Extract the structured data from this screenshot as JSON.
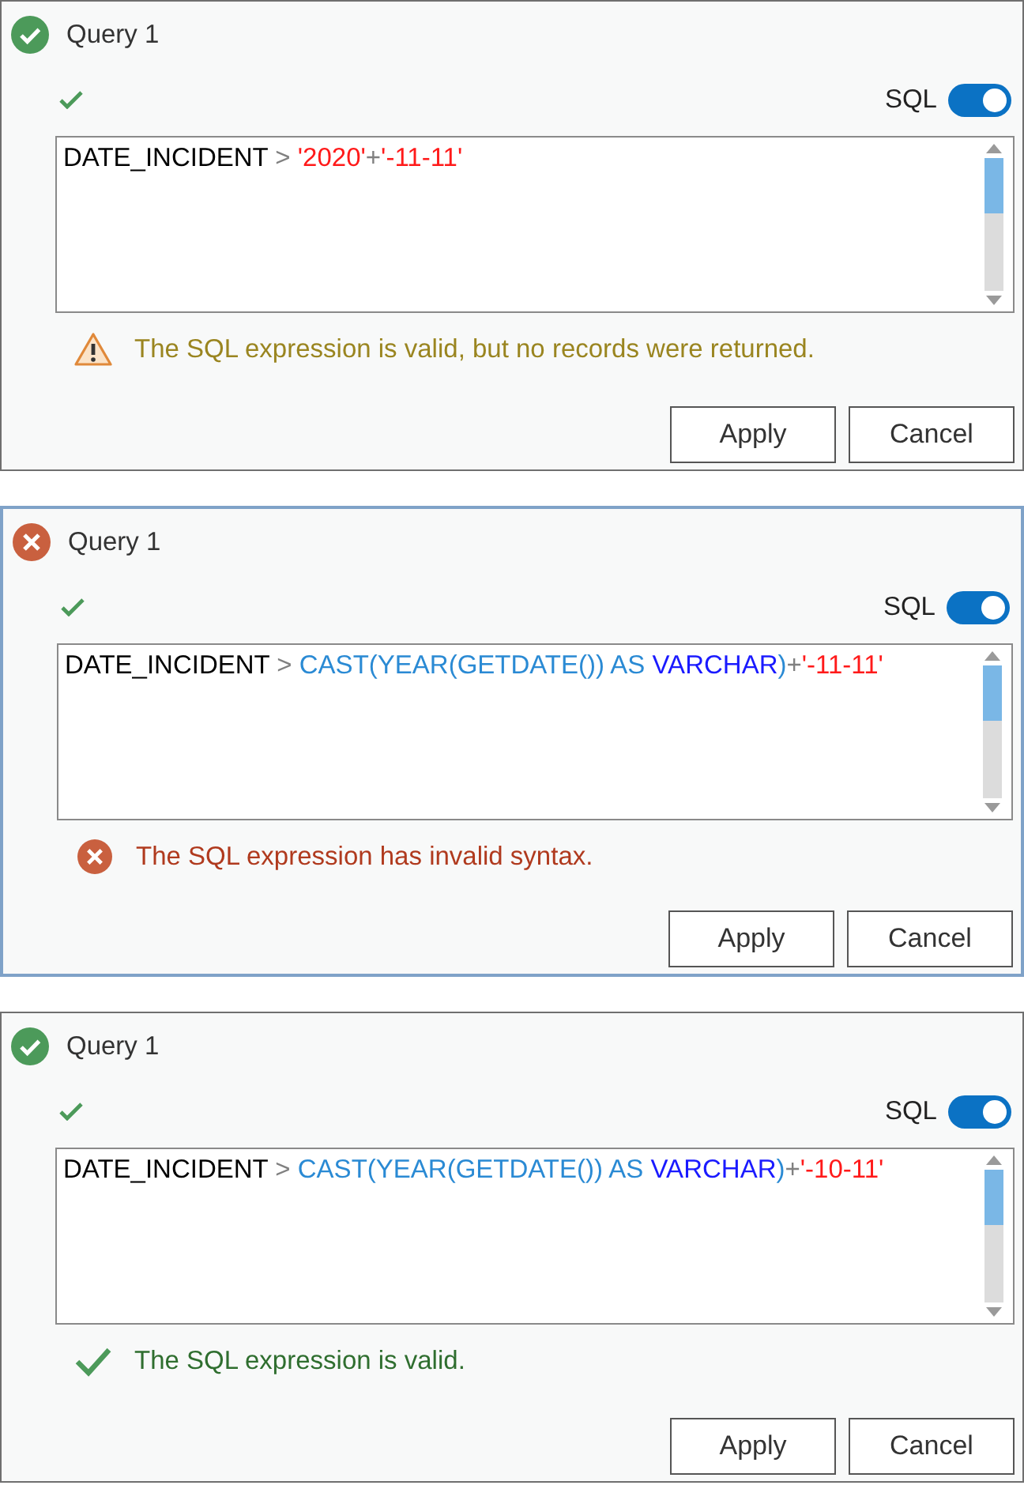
{
  "panels": [
    {
      "valid": true,
      "selected": false,
      "title": "Query 1",
      "toggle": {
        "label": "SQL",
        "on": true
      },
      "expression": [
        {
          "kind": "field",
          "text": "DATE_INCIDENT"
        },
        {
          "kind": "operator",
          "text": " > "
        },
        {
          "kind": "string",
          "text": "'2020'"
        },
        {
          "kind": "operator",
          "text": "+"
        },
        {
          "kind": "string",
          "text": "'-11-11'"
        }
      ],
      "message": {
        "kind": "warning",
        "text": "The SQL expression is valid, but no records were returned."
      },
      "buttons": [
        "Apply",
        "Cancel"
      ]
    },
    {
      "valid": false,
      "selected": true,
      "title": "Query 1",
      "toggle": {
        "label": "SQL",
        "on": true
      },
      "expression": [
        {
          "kind": "field",
          "text": "DATE_INCIDENT"
        },
        {
          "kind": "operator",
          "text": " > "
        },
        {
          "kind": "function",
          "text": "CAST(YEAR(GETDATE()) AS "
        },
        {
          "kind": "keyword",
          "text": "VARCHAR"
        },
        {
          "kind": "function",
          "text": ")"
        },
        {
          "kind": "operator",
          "text": "+"
        },
        {
          "kind": "string",
          "text": "'-11-11'"
        }
      ],
      "message": {
        "kind": "error",
        "text": "The SQL expression has invalid syntax."
      },
      "buttons": [
        "Apply",
        "Cancel"
      ]
    },
    {
      "valid": true,
      "selected": false,
      "title": "Query 1",
      "toggle": {
        "label": "SQL",
        "on": true
      },
      "expression": [
        {
          "kind": "field",
          "text": "DATE_INCIDENT"
        },
        {
          "kind": "operator",
          "text": " > "
        },
        {
          "kind": "function",
          "text": "CAST(YEAR(GETDATE()) AS "
        },
        {
          "kind": "keyword",
          "text": "VARCHAR"
        },
        {
          "kind": "function",
          "text": ")"
        },
        {
          "kind": "operator",
          "text": "+"
        },
        {
          "kind": "string",
          "text": "'-10-11'"
        }
      ],
      "message": {
        "kind": "success",
        "text": "The SQL expression is valid."
      },
      "buttons": [
        "Apply",
        "Cancel"
      ]
    }
  ]
}
